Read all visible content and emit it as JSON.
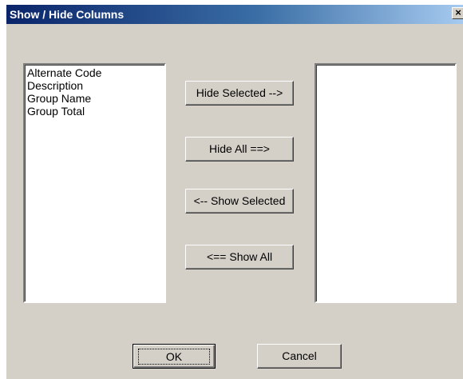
{
  "window": {
    "title": "Show / Hide Columns",
    "close_label": "×"
  },
  "left_list": {
    "items": [
      "Alternate Code",
      "Description",
      "Group Name",
      "Group Total"
    ]
  },
  "right_list": {
    "items": []
  },
  "buttons": {
    "hide_selected": "Hide Selected -->",
    "hide_all": "Hide All ==>",
    "show_selected": "<-- Show Selected",
    "show_all": "<== Show All",
    "ok": "OK",
    "cancel": "Cancel"
  },
  "colors": {
    "face": "#d4d0c8",
    "title_active_start": "#0a246a",
    "title_active_end": "#a6caf0"
  }
}
